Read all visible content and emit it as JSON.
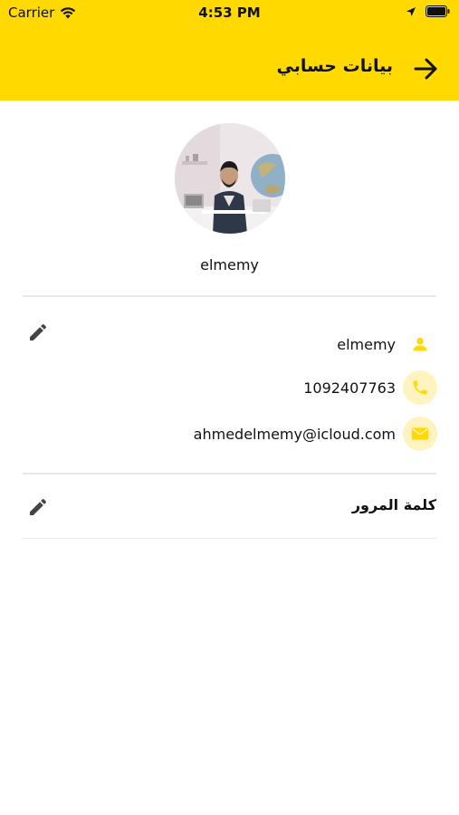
{
  "status_bar": {
    "carrier": "Carrier",
    "time": "4:53 PM"
  },
  "header": {
    "title": "بيانات حسابي",
    "background_color": "#FFD900"
  },
  "profile": {
    "avatar_alt": "profile photo",
    "display_name": "elmemy"
  },
  "account_info": {
    "username": "elmemy",
    "phone": "1092407763",
    "email": "ahmedelmemy@icloud.com"
  },
  "password_section": {
    "label": "كلمة المرور"
  },
  "colors": {
    "accent": "#FFD900",
    "icon_bg": "#FFF3BF",
    "text": "#111111"
  }
}
